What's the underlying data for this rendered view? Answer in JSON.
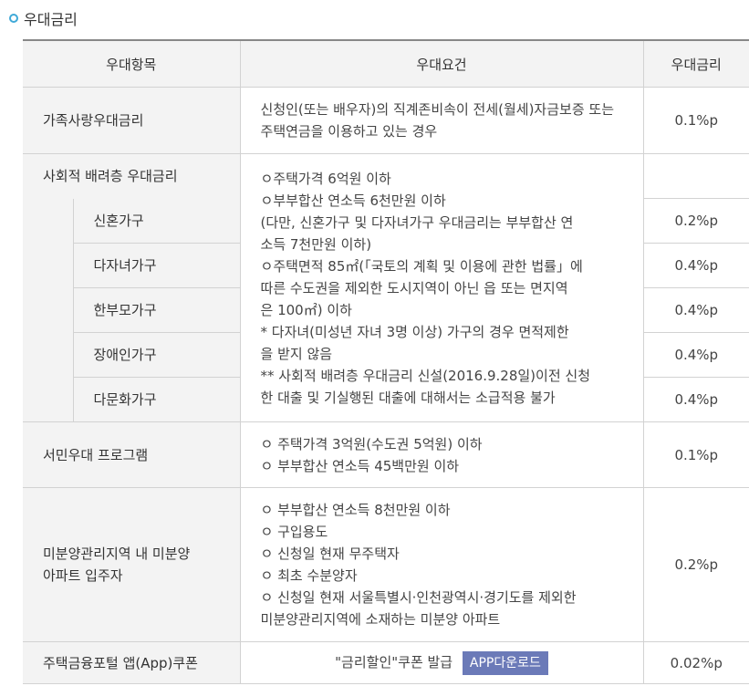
{
  "section_title": "우대금리",
  "headers": [
    "우대항목",
    "우대요건",
    "우대금리"
  ],
  "row_family": {
    "item": "가족사랑우대금리",
    "condition": "신청인(또는 배우자)의 직계존비속이 전세(월세)자금보증 또는 주택연금을 이용하고 있는 경우",
    "rate": "0.1%p"
  },
  "row_social": {
    "item": "사회적 배려층 우대금리",
    "condition_lines": [
      "ㅇ주택가격 6억원 이하",
      "ㅇ부부합산 연소득 6천만원 이하",
      "(다만, 신혼가구 및 다자녀가구 우대금리는 부부합산 연",
      "소득 7천만원 이하)",
      "ㅇ주택면적 85㎡(「국토의 계획 및 이용에 관한 법률」에",
      "따른 수도권을 제외한 도시지역이 아닌 읍 또는 면지역",
      "은 100㎡) 이하",
      "* 다자녀(미성년 자녀 3명 이상) 가구의 경우 면적제한",
      "을 받지 않음",
      "** 사회적 배려층 우대금리 신설(2016.9.28일)이전 신청",
      "한 대출 및 기실행된 대출에 대해서는 소급적용 불가"
    ],
    "subs": [
      {
        "label": "신혼가구",
        "rate": "0.2%p"
      },
      {
        "label": "다자녀가구",
        "rate": "0.4%p"
      },
      {
        "label": "한부모가구",
        "rate": "0.4%p"
      },
      {
        "label": "장애인가구",
        "rate": "0.4%p"
      },
      {
        "label": "다문화가구",
        "rate": "0.4%p"
      }
    ]
  },
  "row_seomin": {
    "item": "서민우대 프로그램",
    "condition_lines": [
      "ㅇ 주택가격 3억원(수도권 5억원) 이하",
      "ㅇ 부부합산 연소득 45백만원 이하"
    ],
    "rate": "0.1%p"
  },
  "row_unsold": {
    "item_lines": [
      "미분양관리지역 내 미분양",
      "아파트 입주자"
    ],
    "condition_lines": [
      "ㅇ 부부합산 연소득 8천만원 이하",
      "ㅇ 구입용도",
      "ㅇ 신청일 현재 무주택자",
      "ㅇ 최초 수분양자",
      "ㅇ 신청일 현재 서울특별시·인천광역시·경기도를 제외한",
      "미분양관리지역에 소재하는 미분양 아파트"
    ],
    "rate": "0.2%p"
  },
  "row_app": {
    "item": "주택금융포털 앱(App)쿠폰",
    "condition": "\"금리할인\"쿠폰 발급",
    "button": "APP다운로드",
    "rate": "0.02%p"
  }
}
